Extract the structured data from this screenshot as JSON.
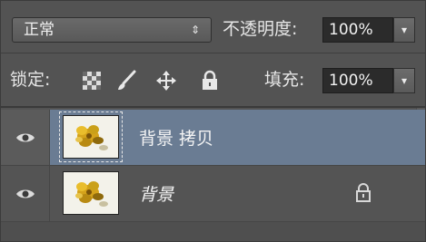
{
  "blend_mode": {
    "value": "正常",
    "arrows": "⇕"
  },
  "opacity": {
    "label": "不透明度:",
    "value": "100%",
    "dropdown_glyph": "▾"
  },
  "lock": {
    "label": "锁定:",
    "icons": [
      "lock-transparent-pixels-icon",
      "lock-image-pixels-brush-icon",
      "lock-position-move-icon",
      "lock-all-padlock-icon"
    ]
  },
  "fill": {
    "label": "填充:",
    "value": "100%",
    "dropdown_glyph": "▾"
  },
  "layers": [
    {
      "name": "背景 拷贝",
      "selected": true,
      "italic": false,
      "locked": false
    },
    {
      "name": "背景",
      "selected": false,
      "italic": true,
      "locked": true
    }
  ],
  "colors": {
    "panel_bg": "#535353",
    "selected_row": "#6a7c93",
    "input_bg": "#2b2b2b"
  }
}
